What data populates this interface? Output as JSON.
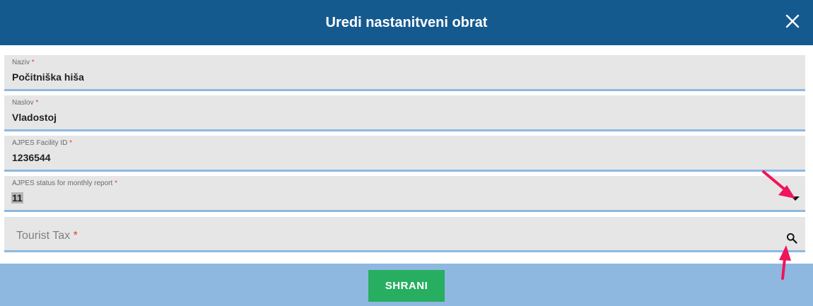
{
  "dialog": {
    "title": "Uredi nastanitveni obrat",
    "close_icon": "close-icon"
  },
  "fields": [
    {
      "label": "Naziv",
      "required_mark": "*",
      "value": "Počitniška hiša"
    },
    {
      "label": "Naslov",
      "required_mark": "*",
      "value": "Vladostoj"
    },
    {
      "label": "AJPES Facility ID",
      "required_mark": "*",
      "value": "1236544"
    },
    {
      "label": "AJPES status for monthly report",
      "required_mark": "*",
      "value": "11",
      "icon": "dropdown-arrow-icon"
    },
    {
      "placeholder": "Tourist Tax",
      "required_mark": "*",
      "value": "",
      "icon": "search-icon"
    }
  ],
  "footer": {
    "save_label": "SHRANI"
  },
  "colors": {
    "header_bg": "#155a8f",
    "field_bg": "#e6e6e6",
    "field_underline": "#8fb8e0",
    "footer_bg": "#8fb8e0",
    "save_bg": "#27ae60",
    "required": "#e53935",
    "annotation_arrow": "#f0145a"
  }
}
